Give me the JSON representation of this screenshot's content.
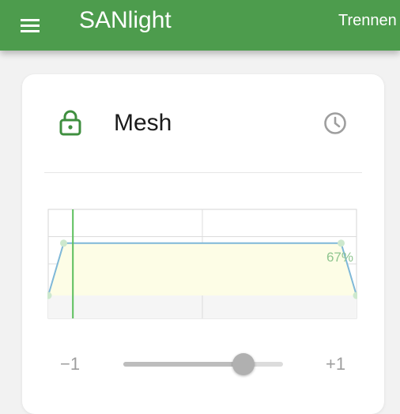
{
  "app_bar": {
    "title": "SANlight",
    "disconnect_label": "Trennen",
    "menu_icon": "hamburger-menu-icon",
    "background_color": "#4d9c4d"
  },
  "card": {
    "title": "Mesh",
    "lock_icon": "lock-icon",
    "clock_icon": "clock-icon",
    "accent_color": "#3f8f3f"
  },
  "chart_data": {
    "type": "line",
    "x": [
      0,
      0.05,
      0.95,
      1
    ],
    "values": [
      0,
      67,
      67,
      0
    ],
    "ylim": [
      0,
      100
    ],
    "annotation": "67%",
    "grid": true,
    "line_color": "#7fb8d8",
    "fill_color": "#fdfde6",
    "marker_color": "#cde8cd",
    "current_time_marker_color": "#5cbf5c",
    "current_time_position": 0.08
  },
  "slider": {
    "min_label": "−1",
    "max_label": "+1",
    "value": 0.5,
    "min": -1,
    "max": 1
  }
}
